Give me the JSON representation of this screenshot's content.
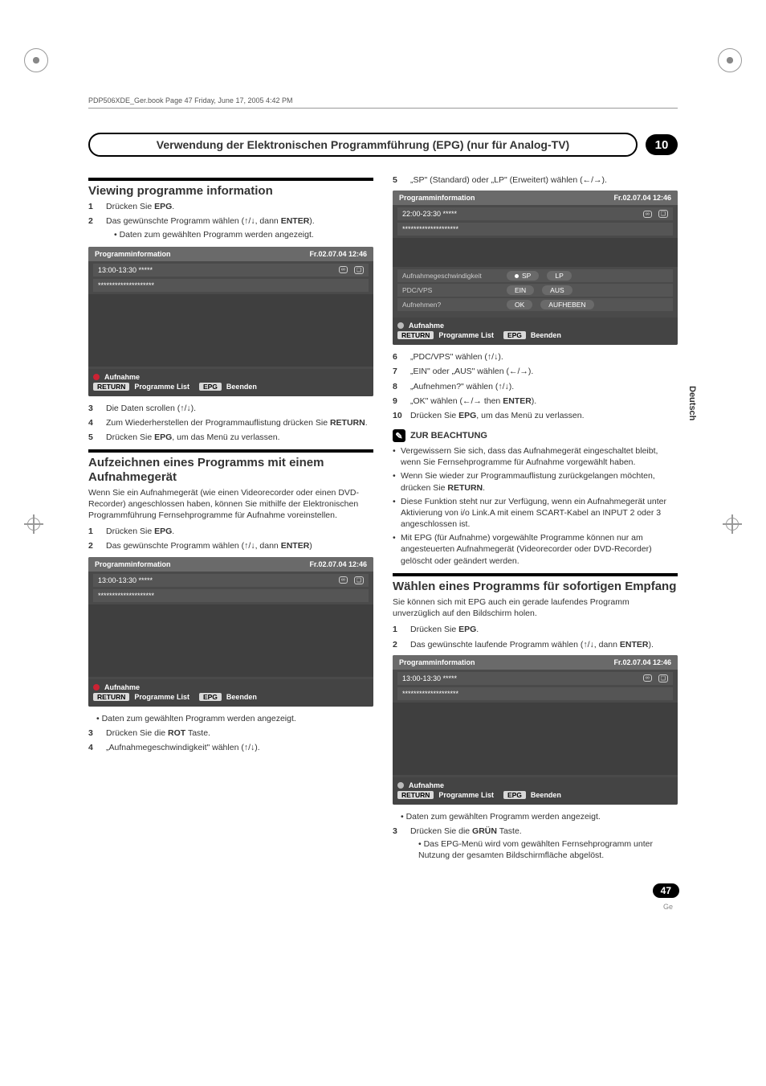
{
  "book_header": "PDP506XDE_Ger.book  Page 47  Friday, June 17, 2005  4:42 PM",
  "chapter": {
    "title": "Verwendung der Elektronischen Programmführung (EPG) (nur für Analog-TV)",
    "number": "10"
  },
  "side_tab": "Deutsch",
  "page_number": "47",
  "page_lang": "Ge",
  "sec1": {
    "heading": "Viewing programme information",
    "steps": [
      {
        "n": "1",
        "t": "Drücken Sie <b>EPG</b>."
      },
      {
        "n": "2",
        "t": "Das gewünschte Programm wählen (↑/↓, dann <b>ENTER</b>).",
        "sub": [
          "Daten zum gewählten Programm werden angezeigt."
        ]
      },
      {
        "n": "3",
        "t": "Die Daten scrollen (↑/↓)."
      },
      {
        "n": "4",
        "t": "Zum Wiederherstellen der Programmauflistung drücken Sie <b>RETURN</b>."
      },
      {
        "n": "5",
        "t": "Drücken Sie <b>EPG</b>, um das Menü zu verlassen."
      }
    ]
  },
  "sec2": {
    "heading": "Aufzeichnen eines Programms mit einem Aufnahmegerät",
    "intro": "Wenn Sie ein Aufnahmegerät (wie einen Videorecorder oder einen DVD-Recorder) angeschlossen haben, können Sie mithilfe der Elektronischen Programmführung Fernsehprogramme für Aufnahme voreinstellen.",
    "steps": [
      {
        "n": "1",
        "t": "Drücken Sie <b>EPG</b>."
      },
      {
        "n": "2",
        "t": "Das gewünschte Programm wählen (↑/↓, dann <b>ENTER</b>)",
        "sub_after_osd": [
          "Daten zum gewählten Programm werden angezeigt."
        ]
      },
      {
        "n": "3",
        "t": "Drücken Sie die <b>ROT</b> Taste."
      },
      {
        "n": "4",
        "t": "„Aufnahmegeschwindigkeit\" wählen (↑/↓)."
      }
    ]
  },
  "right_steps_top": [
    {
      "n": "5",
      "t": "„SP\" (Standard) oder „LP\" (Erweitert) wählen (←/→)."
    }
  ],
  "right_steps_after_osd": [
    {
      "n": "6",
      "t": "„PDC/VPS\" wählen (↑/↓)."
    },
    {
      "n": "7",
      "t": "„EIN\" oder „AUS\" wählen  (←/→)."
    },
    {
      "n": "8",
      "t": "„Aufnehmen?\" wählen (↑/↓)."
    },
    {
      "n": "9",
      "t": "„OK\" wählen (←/→ then <b>ENTER</b>)."
    },
    {
      "n": "10",
      "t": "Drücken Sie <b>EPG</b>, um das Menü zu verlassen."
    }
  ],
  "note": {
    "heading": "ZUR BEACHTUNG",
    "items": [
      "Vergewissern Sie sich, dass das Aufnahmegerät eingeschaltet bleibt, wenn Sie Fernsehprogramme für Aufnahme vorgewählt haben.",
      "Wenn Sie wieder zur Programmauflistung zurückgelangen möchten, drücken Sie <b>RETURN</b>.",
      "Diese Funktion steht nur zur Verfügung, wenn ein Aufnahmegerät unter Aktivierung von i/o Link.A mit einem SCART-Kabel an INPUT 2 oder 3 angeschlossen ist.",
      "Mit EPG (für Aufnahme) vorgewählte Programme können nur am angesteuerten Aufnahmegerät (Videorecorder oder DVD-Recorder) gelöscht oder geändert werden."
    ]
  },
  "sec3": {
    "heading": "Wählen eines Programms für sofortigen Empfang",
    "intro": "Sie können sich mit EPG auch ein gerade laufendes Programm unverzüglich auf den Bildschirm holen.",
    "steps": [
      {
        "n": "1",
        "t": "Drücken Sie <b>EPG</b>."
      },
      {
        "n": "2",
        "t": "Das gewünschte laufende Programm wählen (↑/↓, dann <b>ENTER</b>).",
        "sub_after_osd": [
          "Daten zum gewählten Programm werden angezeigt."
        ]
      },
      {
        "n": "3",
        "t": "Drücken Sie die <b>GRÜN</b> Taste.",
        "sub": [
          "Das EPG-Menü wird vom gewählten Fernsehprogramm unter Nutzung der gesamten Bildschirmfläche abgelöst."
        ]
      }
    ]
  },
  "osd_common": {
    "title": "Programminformation",
    "datetime": "Fr.02.07.04 12:46",
    "time_a": "13:00-13:30 *****",
    "time_b": "22:00-23:30 *****",
    "stars": "********************",
    "footer_rec": "Aufnahme",
    "footer_return": "RETURN",
    "footer_plist": "Programme List",
    "footer_epg": "EPG",
    "footer_end": "Beenden"
  },
  "osd_settings": {
    "speed_label": "Aufnahmegeschwindigkeit",
    "sp": "SP",
    "lp": "LP",
    "pdc_label": "PDC/VPS",
    "ein": "EIN",
    "aus": "AUS",
    "rec_label": "Aufnehmen?",
    "ok": "OK",
    "cancel": "AUFHEBEN"
  }
}
